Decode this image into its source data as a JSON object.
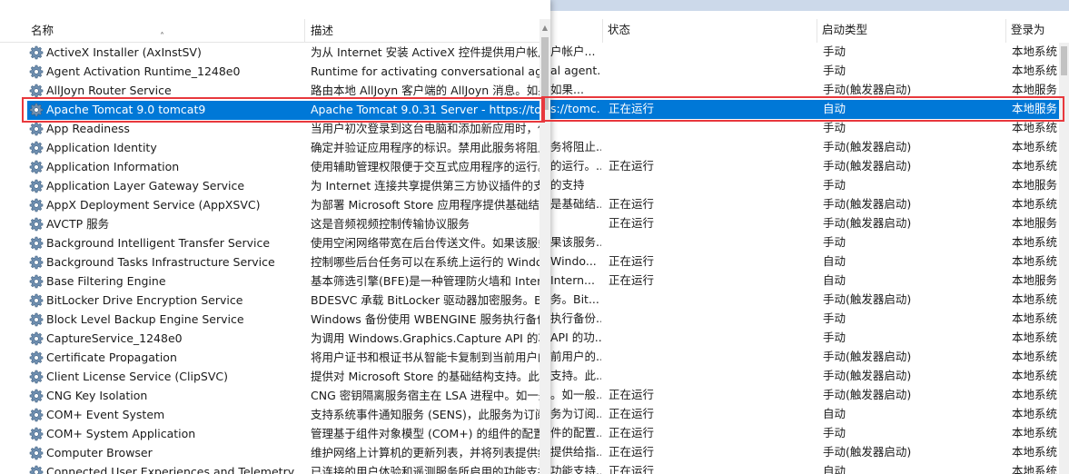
{
  "right_panel": {
    "columns": {
      "status": "状态",
      "startup_type": "启动类型",
      "logon_as": "登录为"
    },
    "rows": [
      {
        "desc": "户帐户...",
        "status": "",
        "startup": "手动",
        "logon": "本地系统"
      },
      {
        "desc": "al agent...",
        "status": "",
        "startup": "手动",
        "logon": "本地系统"
      },
      {
        "desc": "如果...",
        "status": "",
        "startup": "手动(触发器启动)",
        "logon": "本地服务"
      },
      {
        "desc": "s://tomc...",
        "status": "正在运行",
        "startup": "自动",
        "logon": "本地服务"
      },
      {
        "desc": "",
        "status": "",
        "startup": "手动",
        "logon": "本地系统"
      },
      {
        "desc": "务将阻止...",
        "status": "",
        "startup": "手动(触发器启动)",
        "logon": "本地系统"
      },
      {
        "desc": "的运行。...",
        "status": "正在运行",
        "startup": "手动(触发器启动)",
        "logon": "本地系统"
      },
      {
        "desc": "的支持",
        "status": "",
        "startup": "手动",
        "logon": "本地服务"
      },
      {
        "desc": "是基础结...",
        "status": "正在运行",
        "startup": "手动(触发器启动)",
        "logon": "本地系统"
      },
      {
        "desc": "",
        "status": "正在运行",
        "startup": "手动(触发器启动)",
        "logon": "本地服务"
      },
      {
        "desc": "果该服务...",
        "status": "",
        "startup": "手动",
        "logon": "本地系统"
      },
      {
        "desc": "Windo...",
        "status": "正在运行",
        "startup": "自动",
        "logon": "本地系统"
      },
      {
        "desc": "Intern...",
        "status": "正在运行",
        "startup": "自动",
        "logon": "本地服务"
      },
      {
        "desc": "务。Bit...",
        "status": "",
        "startup": "手动(触发器启动)",
        "logon": "本地系统"
      },
      {
        "desc": "执行备份...",
        "status": "",
        "startup": "手动",
        "logon": "本地系统"
      },
      {
        "desc": "API 的功...",
        "status": "",
        "startup": "手动",
        "logon": "本地系统"
      },
      {
        "desc": "前用户的...",
        "status": "",
        "startup": "手动(触发器启动)",
        "logon": "本地系统"
      },
      {
        "desc": "支持。此...",
        "status": "",
        "startup": "手动(触发器启动)",
        "logon": "本地系统"
      },
      {
        "desc": "。如一般...",
        "status": "正在运行",
        "startup": "手动(触发器启动)",
        "logon": "本地系统"
      },
      {
        "desc": "务为订阅...",
        "status": "正在运行",
        "startup": "自动",
        "logon": "本地系统"
      },
      {
        "desc": "件的配置...",
        "status": "正在运行",
        "startup": "手动",
        "logon": "本地系统"
      },
      {
        "desc": "提供给指...",
        "status": "正在运行",
        "startup": "手动(触发器启动)",
        "logon": "本地系统"
      },
      {
        "desc": "功能支持...",
        "status": "正在运行",
        "startup": "自动",
        "logon": "本地系统"
      }
    ]
  },
  "left_panel": {
    "columns": {
      "name": "名称",
      "description": "描述"
    },
    "rows": [
      {
        "name": "ActiveX Installer (AxInstSV)",
        "desc": "为从 Internet 安装 ActiveX 控件提供用户帐户..."
      },
      {
        "name": "Agent Activation Runtime_1248e0",
        "desc": "Runtime for activating conversational agent..."
      },
      {
        "name": "AllJoyn Router Service",
        "desc": "路由本地 AllJoyn 客户端的 AllJoyn 消息。如果..."
      },
      {
        "name": "Apache Tomcat 9.0 tomcat9",
        "desc": "Apache Tomcat 9.0.31 Server - https://tomc..."
      },
      {
        "name": "App Readiness",
        "desc": "当用户初次登录到这台电脑和添加新应用时，使..."
      },
      {
        "name": "Application Identity",
        "desc": "确定并验证应用程序的标识。禁用此服务将阻止..."
      },
      {
        "name": "Application Information",
        "desc": "使用辅助管理权限便于交互式应用程序的运行。..."
      },
      {
        "name": "Application Layer Gateway Service",
        "desc": "为 Internet 连接共享提供第三方协议插件的支持"
      },
      {
        "name": "AppX Deployment Service (AppXSVC)",
        "desc": "为部署 Microsoft Store 应用程序提供基础结..."
      },
      {
        "name": "AVCTP 服务",
        "desc": "这是音频视频控制传输协议服务"
      },
      {
        "name": "Background Intelligent Transfer Service",
        "desc": "使用空闲网络带宽在后台传送文件。如果该服务..."
      },
      {
        "name": "Background Tasks Infrastructure Service",
        "desc": "控制哪些后台任务可以在系统上运行的 Windo..."
      },
      {
        "name": "Base Filtering Engine",
        "desc": "基本筛选引擎(BFE)是一种管理防火墙和 Intern..."
      },
      {
        "name": "BitLocker Drive Encryption Service",
        "desc": "BDESVC 承载 BitLocker 驱动器加密服务。Bit..."
      },
      {
        "name": "Block Level Backup Engine Service",
        "desc": "Windows 备份使用 WBENGINE 服务执行备份..."
      },
      {
        "name": "CaptureService_1248e0",
        "desc": "为调用 Windows.Graphics.Capture API 的功..."
      },
      {
        "name": "Certificate Propagation",
        "desc": "将用户证书和根证书从智能卡复制到当前用户的..."
      },
      {
        "name": "Client License Service (ClipSVC)",
        "desc": "提供对 Microsoft Store 的基础结构支持。此..."
      },
      {
        "name": "CNG Key Isolation",
        "desc": "CNG 密钥隔离服务宿主在 LSA 进程中。如一般..."
      },
      {
        "name": "COM+ Event System",
        "desc": "支持系统事件通知服务 (SENS)，此服务为订阅..."
      },
      {
        "name": "COM+ System Application",
        "desc": "管理基于组件对象模型 (COM+) 的组件的配置..."
      },
      {
        "name": "Computer Browser",
        "desc": "维护网络上计算机的更新列表，并将列表提供给..."
      },
      {
        "name": "Connected User Experiences and Telemetry",
        "desc": "已连接的用户体验和遥测服务所启用的功能支持..."
      }
    ]
  },
  "selected_index": 3,
  "colors": {
    "selection": "#0078d7",
    "highlight_box": "#e8383d",
    "scrollbar_thumb": "#c2c2c2"
  },
  "icons": {
    "service": "gear-icon",
    "sort": "sort-ascending-icon"
  }
}
